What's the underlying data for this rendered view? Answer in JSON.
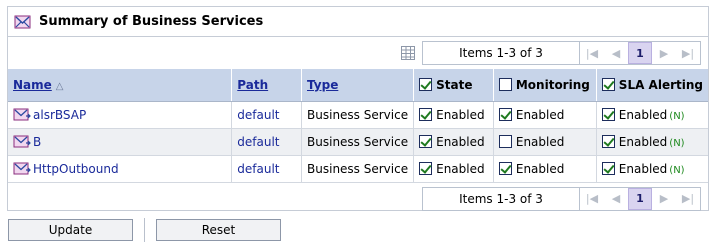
{
  "panel": {
    "title": "Summary of Business Services",
    "icon": "business-service-icon"
  },
  "pager": {
    "items_text": "Items 1-3 of 3",
    "current_page": "1",
    "first": "first-page-icon",
    "prev": "prev-page-icon",
    "next": "next-page-icon",
    "last": "last-page-icon"
  },
  "columns": {
    "name": "Name",
    "path": "Path",
    "type": "Type",
    "state": "State",
    "monitoring": "Monitoring",
    "sla": "SLA Alerting"
  },
  "header_checks": {
    "state": true,
    "monitoring": false,
    "sla": true
  },
  "rows": [
    {
      "name": "alsrBSAP",
      "path": "default",
      "type": "Business Service",
      "state": "Enabled",
      "state_checked": true,
      "monitoring": "Enabled",
      "monitoring_checked": true,
      "sla": "Enabled",
      "sla_checked": true,
      "sla_badge": "(N)"
    },
    {
      "name": "B",
      "path": "default",
      "type": "Business Service",
      "state": "Enabled",
      "state_checked": true,
      "monitoring": "Enabled",
      "monitoring_checked": false,
      "sla": "Enabled",
      "sla_checked": true,
      "sla_badge": "(N)"
    },
    {
      "name": "HttpOutbound",
      "path": "default",
      "type": "Business Service",
      "state": "Enabled",
      "state_checked": true,
      "monitoring": "Enabled",
      "monitoring_checked": true,
      "sla": "Enabled",
      "sla_checked": true,
      "sla_badge": "(N)"
    }
  ],
  "buttons": {
    "update": "Update",
    "reset": "Reset"
  },
  "colors": {
    "header_bg": "#c7d4e9",
    "link": "#1a2a9a",
    "check": "#1f7a1f",
    "current_page_bg": "#d9d4f0"
  }
}
